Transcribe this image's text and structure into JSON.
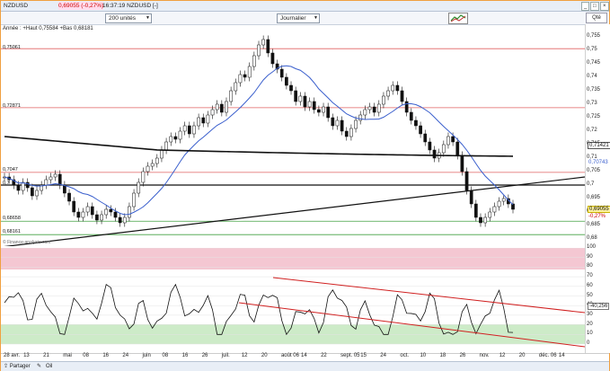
{
  "topbar": {
    "instrument": "NZDUSD",
    "price": "0,69055 (-0,27%)",
    "time_line": "16:37:19 NZDUSD [-]",
    "close": "×",
    "max": "□",
    "min": "_"
  },
  "toolbar": {
    "units_select": "200 unités",
    "journal_select": "Journalier",
    "q_label": "Qté"
  },
  "info_line": "Année : +Haut 0,75584 +Bas 0,68181",
  "hlines": [
    "0,75061",
    "0,72871",
    "0,7047",
    "0,7",
    "0,68658",
    "0,68161"
  ],
  "yaxis": [
    "0,755",
    "0,75",
    "0,745",
    "0,74",
    "0,735",
    "0,73",
    "0,725",
    "0,72",
    "0,715",
    "0,71",
    "0,705",
    "0,7",
    "0,695",
    "0,69",
    "0,685",
    "0,68"
  ],
  "price_badges": {
    "ma_short": "0,71421",
    "ma_long": "0,70743",
    "last": "0,69055",
    "change": "-0,27%"
  },
  "indicator_source": "© Finance-analysis.com",
  "indicator_axis": [
    "100",
    "90",
    "80",
    "70",
    "60",
    "50",
    "40",
    "30",
    "20",
    "10",
    "0"
  ],
  "indicator_value": "-40,256",
  "xaxis": [
    "28 avr.",
    "13",
    "21",
    "mai",
    "08",
    "16",
    "24",
    "juin",
    "08",
    "16",
    "26",
    "juil.",
    "12",
    "20",
    "août 06",
    "14",
    "22",
    "sept. 05",
    "15",
    "24",
    "oct.",
    "10",
    "18",
    "26",
    "nov.",
    "12",
    "20",
    "déc. 06",
    "14"
  ],
  "bottombar": {
    "share": "Partager",
    "toolbar_hint": "Oil"
  },
  "colors": {
    "frame": "#f0a040",
    "up_candle": "#ffffff",
    "down_candle": "#111111",
    "ma50": "#3a5fcd",
    "ma200": "#111111",
    "hline_red": "#e06060",
    "hline_green": "#40a040",
    "ind_red_zone": "#f4c7d2",
    "ind_green_zone": "#cdebc8",
    "channel": "#d02020"
  }
}
